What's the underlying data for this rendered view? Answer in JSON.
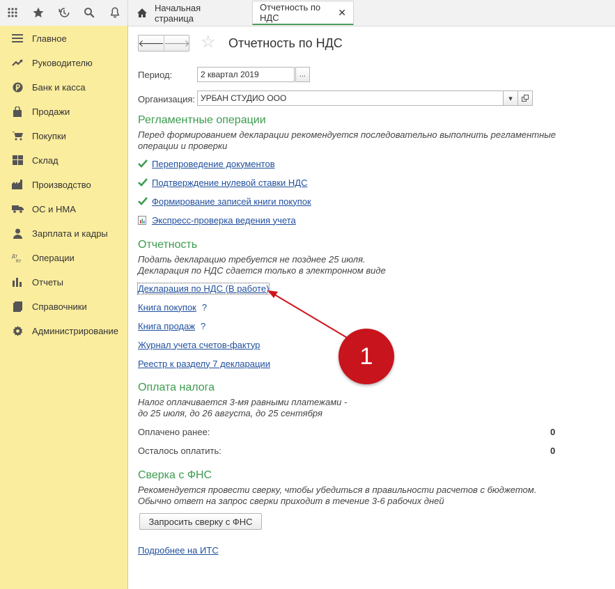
{
  "tabs": {
    "home": "Начальная страница",
    "active": "Отчетность по НДС",
    "close": "✕"
  },
  "sidebar": {
    "items": [
      {
        "label": "Главное",
        "icon": "menu-icon"
      },
      {
        "label": "Руководителю",
        "icon": "trend-icon"
      },
      {
        "label": "Банк и касса",
        "icon": "bank-icon"
      },
      {
        "label": "Продажи",
        "icon": "bag-icon"
      },
      {
        "label": "Покупки",
        "icon": "cart-icon"
      },
      {
        "label": "Склад",
        "icon": "warehouse-icon"
      },
      {
        "label": "Производство",
        "icon": "factory-icon"
      },
      {
        "label": "ОС и НМА",
        "icon": "truck-icon"
      },
      {
        "label": "Зарплата и кадры",
        "icon": "person-icon"
      },
      {
        "label": "Операции",
        "icon": "dt-kt-icon"
      },
      {
        "label": "Отчеты",
        "icon": "bar-chart-icon"
      },
      {
        "label": "Справочники",
        "icon": "book-icon"
      },
      {
        "label": "Администрирование",
        "icon": "gear-icon"
      }
    ]
  },
  "header": {
    "back": "🡐",
    "forward": "🡒",
    "title": "Отчетность по НДС"
  },
  "form": {
    "period_label": "Период:",
    "period_value": "2 квартал 2019",
    "period_btn": "...",
    "org_label": "Организация:",
    "org_value": "УРБАН СТУДИО ООО"
  },
  "reglament": {
    "title": "Регламентные операции",
    "desc1": "Перед формированием декларации рекомендуется последовательно выполнить регламентные",
    "desc2": "операции и проверки",
    "links": [
      "Перепроведение документов",
      "Подтверждение нулевой ставки НДС",
      "Формирование записей книги покупок",
      "Экспресс-проверка ведения учета"
    ]
  },
  "reports": {
    "title": "Отчетность",
    "desc1": "Подать декларацию требуется не позднее 25 июля.",
    "desc2": "Декларация по НДС сдается только в электронном виде",
    "declaration": "Декларация по НДС (В работе)",
    "purchases": "Книга покупок",
    "sales": "Книга продаж",
    "journal": "Журнал учета счетов-фактур",
    "registry": "Реестр к разделу 7 декларации",
    "help": "?"
  },
  "payment": {
    "title": "Оплата налога",
    "desc1": "Налог оплачивается 3-мя равными платежами -",
    "desc2": "до 25 июля, до 26 августа, до 25 сентября",
    "paid_label": "Оплачено ранее:",
    "paid_value": "0",
    "left_label": "Осталось оплатить:",
    "left_value": "0"
  },
  "fns": {
    "title": "Сверка с ФНС",
    "desc1": "Рекомендуется провести сверку, чтобы убедиться в правильности расчетов с бюджетом.",
    "desc2": "Обычно ответ на запрос сверки приходит в течение 3-6 рабочих дней",
    "button": "Запросить сверку с ФНС",
    "more": "Подробнее на ИТС"
  },
  "annotation": {
    "number": "1"
  },
  "colors": {
    "sidebar_bg": "#fbed9e",
    "section_green": "#3c9b4e",
    "link_blue": "#1f4f9e",
    "badge_red": "#c8141c"
  }
}
